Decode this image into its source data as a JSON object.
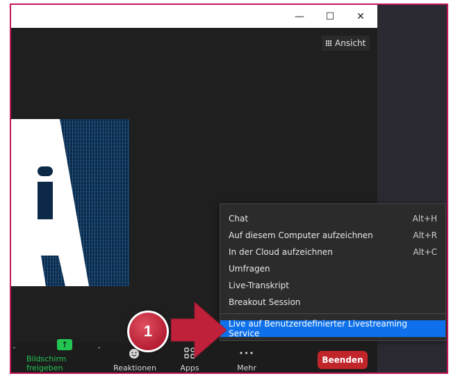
{
  "window": {
    "minimize_glyph": "—",
    "maximize_glyph": "☐",
    "close_glyph": "✕"
  },
  "view_button": {
    "label": "Ansicht",
    "icon": "grid-icon"
  },
  "menu": {
    "items": [
      {
        "label": "Chat",
        "shortcut": "Alt+H"
      },
      {
        "label": "Auf diesem Computer aufzeichnen",
        "shortcut": "Alt+R"
      },
      {
        "label": "In der Cloud aufzeichnen",
        "shortcut": "Alt+C"
      },
      {
        "label": "Umfragen",
        "shortcut": ""
      },
      {
        "label": "Live-Transkript",
        "shortcut": ""
      },
      {
        "label": "Breakout Session",
        "shortcut": ""
      }
    ],
    "highlighted": {
      "label": "Live auf Benutzerdefinierter Livestreaming Service"
    }
  },
  "toolbar": {
    "share": {
      "label": "Bildschirm freigeben",
      "icon": "share-screen-icon",
      "color": "#23c552"
    },
    "reactions": {
      "label": "Reaktionen",
      "icon": "smiley-icon"
    },
    "apps": {
      "label": "Apps",
      "icon": "apps-icon"
    },
    "more": {
      "label": "Mehr",
      "icon": "more-dots-icon",
      "glyph": "•••"
    },
    "end": {
      "label": "Beenden",
      "color": "#c0252a"
    }
  },
  "callout": {
    "number": "1",
    "color": "#c0213a"
  },
  "colors": {
    "frame_border": "#c2185b",
    "highlight": "#0e71eb"
  }
}
